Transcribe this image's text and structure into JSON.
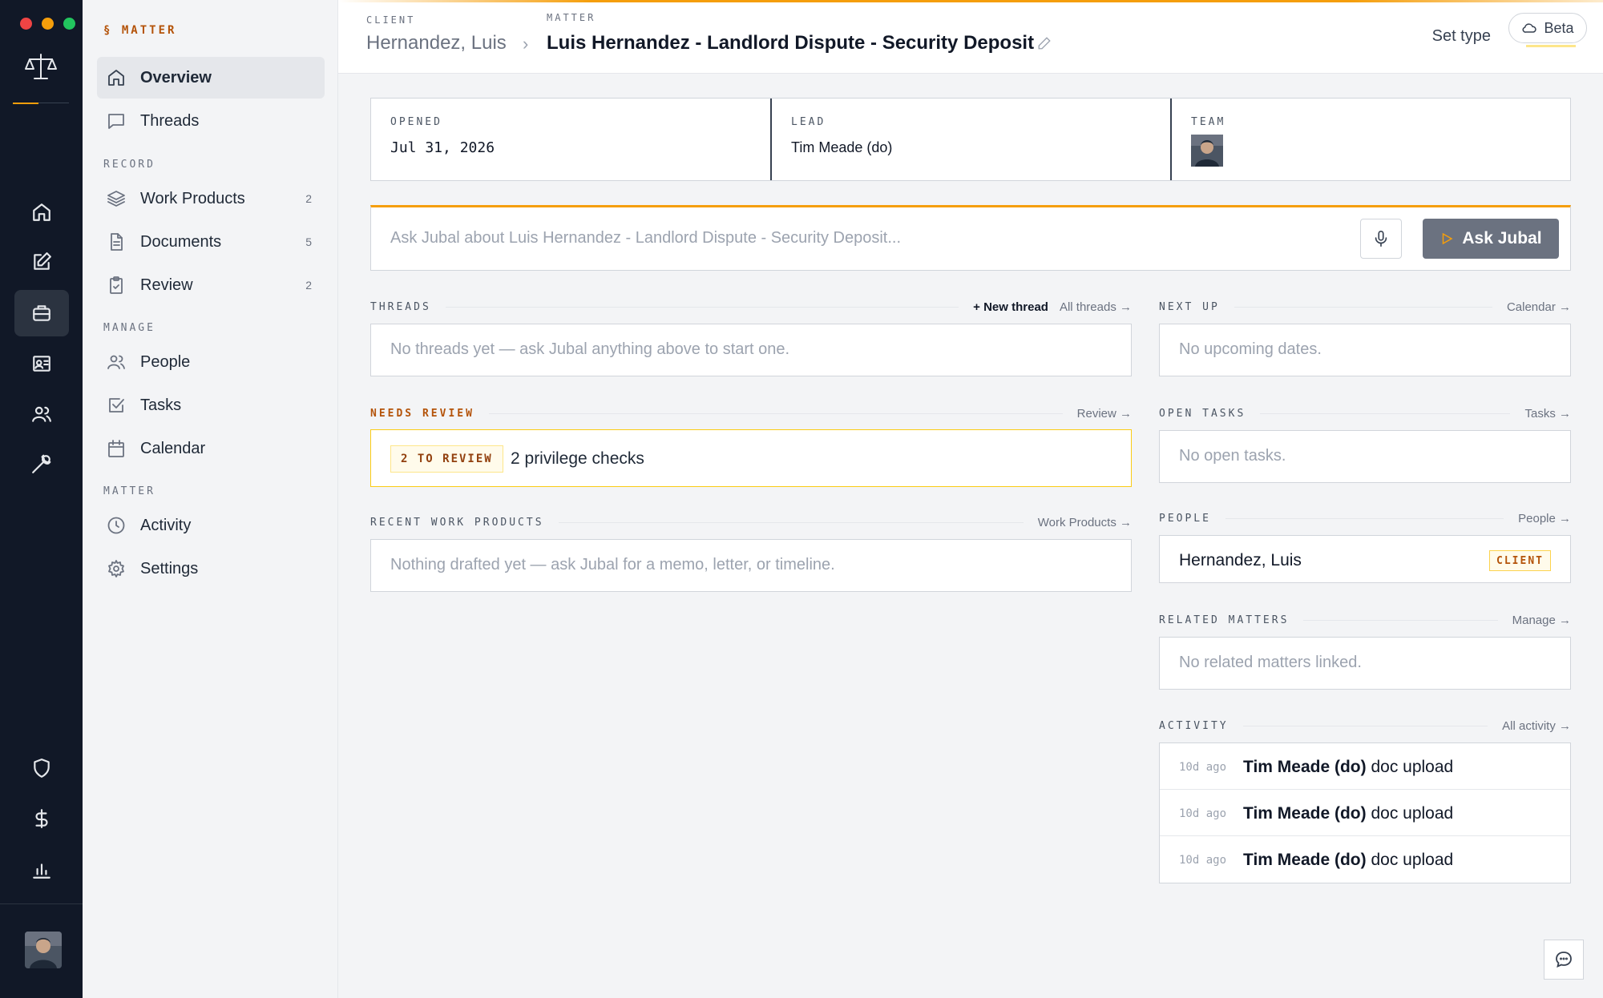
{
  "colors": {
    "rail_bg": "#111827",
    "accent": "#f59e0b",
    "review_accent": "#b45309",
    "traffic": [
      "#ef4444",
      "#f59e0b",
      "#22c55e"
    ]
  },
  "rail": {
    "items": [
      {
        "icon": "home-icon"
      },
      {
        "icon": "edit-icon"
      },
      {
        "icon": "briefcase-icon"
      },
      {
        "icon": "contact-card-icon"
      },
      {
        "icon": "users-icon"
      },
      {
        "icon": "wrench-icon"
      }
    ],
    "bottom_items": [
      {
        "icon": "shield-icon"
      },
      {
        "icon": "dollar-icon"
      },
      {
        "icon": "bar-chart-icon"
      }
    ]
  },
  "sidebar": {
    "heading": "§ MATTER",
    "top_items": [
      {
        "label": "Overview",
        "icon": "home-icon"
      },
      {
        "label": "Threads",
        "icon": "message-icon"
      }
    ],
    "record_title": "RECORD",
    "record_items": [
      {
        "label": "Work Products",
        "icon": "layers-icon",
        "count": "2"
      },
      {
        "label": "Documents",
        "icon": "document-icon",
        "count": "5"
      },
      {
        "label": "Review",
        "icon": "clipboard-check-icon",
        "count": "2"
      }
    ],
    "manage_title": "MANAGE",
    "manage_items": [
      {
        "label": "People",
        "icon": "users-icon"
      },
      {
        "label": "Tasks",
        "icon": "checkbox-icon"
      },
      {
        "label": "Calendar",
        "icon": "calendar-icon"
      }
    ],
    "matter_title": "MATTER",
    "matter_items": [
      {
        "label": "Activity",
        "icon": "clock-icon"
      },
      {
        "label": "Settings",
        "icon": "gear-icon"
      }
    ]
  },
  "header": {
    "client_label": "CLIENT",
    "client_name": "Hernandez, Luis",
    "matter_label": "MATTER",
    "matter_name": "Luis Hernandez - Landlord Dispute - Security Deposit",
    "set_type": "Set type",
    "beta": "Beta"
  },
  "stats": {
    "opened_label": "OPENED",
    "opened_value": "Jul 31, 2026",
    "lead_label": "LEAD",
    "lead_value": "Tim Meade (do)",
    "team_label": "TEAM"
  },
  "ask": {
    "placeholder": "Ask Jubal about Luis Hernandez - Landlord Dispute - Security Deposit...",
    "button": "Ask Jubal"
  },
  "threads": {
    "title": "THREADS",
    "new_thread": "+ New thread",
    "all_threads": "All threads →",
    "empty": "No threads yet — ask Jubal anything above to start one."
  },
  "needs_review": {
    "title": "NEEDS REVIEW",
    "link": "Review →",
    "badge": "2 TO REVIEW",
    "text": "2 privilege checks"
  },
  "recent_work": {
    "title": "RECENT WORK PRODUCTS",
    "link": "Work Products →",
    "empty": "Nothing drafted yet — ask Jubal for a memo, letter, or timeline."
  },
  "next_up": {
    "title": "NEXT UP",
    "link": "Calendar →",
    "empty": "No upcoming dates."
  },
  "open_tasks": {
    "title": "OPEN TASKS",
    "link": "Tasks →",
    "empty": "No open tasks."
  },
  "people": {
    "title": "PEOPLE",
    "link": "People →",
    "name": "Hernandez, Luis",
    "badge": "CLIENT"
  },
  "related": {
    "title": "RELATED MATTERS",
    "link": "Manage →",
    "empty": "No related matters linked."
  },
  "activity": {
    "title": "ACTIVITY",
    "link": "All activity →",
    "rows": [
      {
        "time": "10d ago",
        "who": "Tim Meade (do)",
        "what": "doc upload"
      },
      {
        "time": "10d ago",
        "who": "Tim Meade (do)",
        "what": "doc upload"
      },
      {
        "time": "10d ago",
        "who": "Tim Meade (do)",
        "what": "doc upload"
      }
    ]
  }
}
